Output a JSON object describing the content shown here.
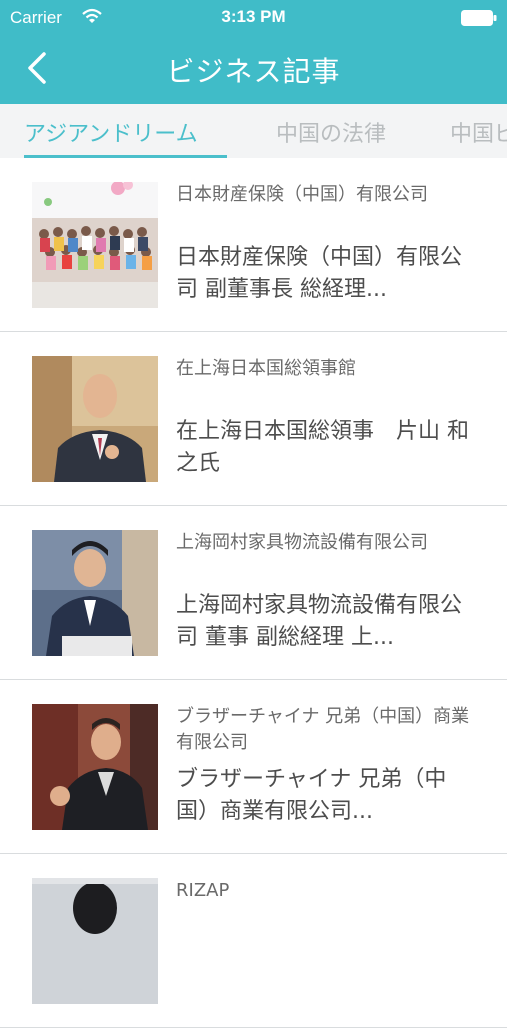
{
  "status": {
    "carrier": "Carrier",
    "time": "3:13 PM"
  },
  "header": {
    "title": "ビジネス記事"
  },
  "tabs": [
    {
      "label": "アジアンドリーム",
      "active": true
    },
    {
      "label": "中国の法律",
      "active": false
    },
    {
      "label": "中国ビ",
      "active": false
    }
  ],
  "articles": [
    {
      "company": "日本財産保険（中国）有限公司",
      "title": "日本財産保険（中国）有限公司 副董事長 総経理..."
    },
    {
      "company": "在上海日本国総領事館",
      "title": "在上海日本国総領事　片山 和之氏"
    },
    {
      "company": "上海岡村家具物流設備有限公司",
      "title": "上海岡村家具物流設備有限公司 董事 副総経理 上..."
    },
    {
      "company": "ブラザーチャイナ 兄弟（中国）商業有限公司",
      "title": "ブラザーチャイナ 兄弟（中国）商業有限公司..."
    },
    {
      "company": "RIZAP",
      "title": ""
    }
  ],
  "colors": {
    "accent": "#40bcc8",
    "tab_active": "#4bbfcb",
    "tab_inactive": "#b9bdbf"
  }
}
